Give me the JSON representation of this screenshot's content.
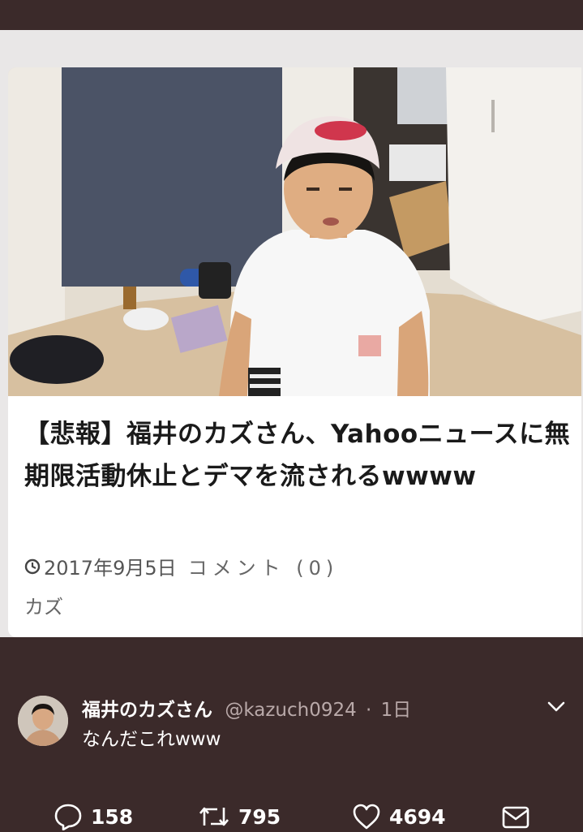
{
  "article": {
    "headline": "【悲報】福井のカズさん、Yahooニュースに無期限活動休止とデマを流されるwwww",
    "date": "2017年9月5日",
    "comments": "コメント (0)",
    "category": "カズ",
    "image": "man-in-white-tshirt-and-cap-photo"
  },
  "tweet": {
    "display_name": "福井のカズさん",
    "handle": "@kazuch0924",
    "separator": "·",
    "time": "1日",
    "text": "なんだこれwww",
    "replies": "158",
    "retweets": "795",
    "likes": "4694"
  },
  "icons": {
    "clock": "clock-icon",
    "chevron": "chevron-down-icon",
    "reply": "reply-icon",
    "retweet": "retweet-icon",
    "like": "heart-icon",
    "message": "mail-icon"
  },
  "colors": {
    "background": "#3b2a2a",
    "card": "#ffffff",
    "text_muted": "#b9a9a9"
  }
}
